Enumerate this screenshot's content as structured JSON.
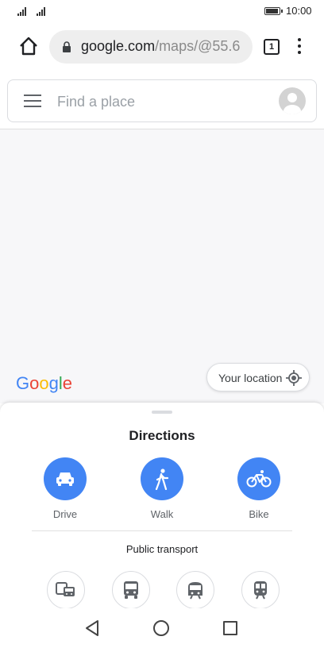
{
  "status_bar": {
    "time": "10:00"
  },
  "browser": {
    "url_host": "google.com",
    "url_path": "/maps/@55.6",
    "tab_count": "1"
  },
  "search": {
    "placeholder": "Find a place"
  },
  "map": {
    "logo_letters": [
      "G",
      "o",
      "o",
      "g",
      "l",
      "e"
    ],
    "your_location_label": "Your location"
  },
  "directions": {
    "title": "Directions",
    "modes": [
      {
        "label": "Drive",
        "icon": "car-icon"
      },
      {
        "label": "Walk",
        "icon": "walk-icon"
      },
      {
        "label": "Bike",
        "icon": "bike-icon"
      }
    ],
    "public_transport_label": "Public transport",
    "transit_icons": [
      "bus-train-icon",
      "bus-icon",
      "tram-icon",
      "train-icon"
    ]
  },
  "colors": {
    "accent": "#4285f4",
    "google_blue": "#4285F4",
    "google_red": "#EA4335",
    "google_yellow": "#FBBC05",
    "google_green": "#34A853"
  }
}
